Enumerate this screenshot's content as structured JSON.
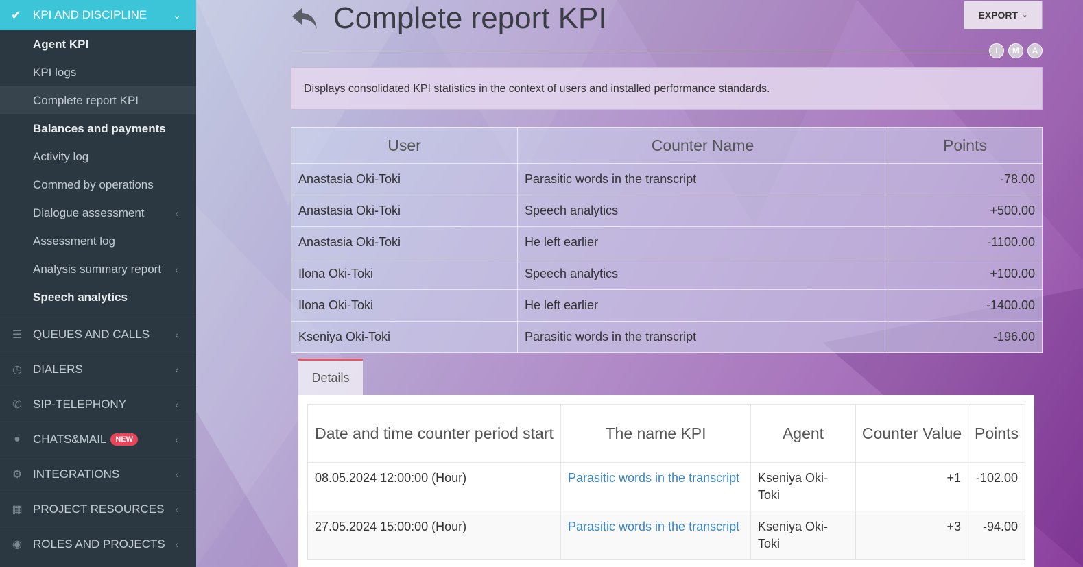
{
  "sidebar": {
    "top": {
      "label": "KPI AND DISCIPLINE",
      "icon": "check-icon"
    },
    "subitems": [
      {
        "label": "Agent KPI"
      },
      {
        "label": "KPI logs"
      },
      {
        "label": "Complete report KPI"
      },
      {
        "label": "Balances and payments"
      },
      {
        "label": "Activity log"
      },
      {
        "label": "Commed by operations"
      },
      {
        "label": "Dialogue assessment"
      },
      {
        "label": "Assessment log"
      },
      {
        "label": "Analysis summary report"
      },
      {
        "label": "Speech analytics"
      }
    ],
    "groups": [
      {
        "label": "QUEUES AND CALLS",
        "icon": "list-icon"
      },
      {
        "label": "DIALERS",
        "icon": "clock-icon"
      },
      {
        "label": "SIP-TELEPHONY",
        "icon": "phone-icon"
      },
      {
        "label": "CHATS&MAIL",
        "icon": "chat-icon",
        "badge": "NEW"
      },
      {
        "label": "INTEGRATIONS",
        "icon": "gears-icon"
      },
      {
        "label": "PROJECT RESOURCES",
        "icon": "grid-icon"
      },
      {
        "label": "ROLES AND PROJECTS",
        "icon": "toggle-icon"
      }
    ]
  },
  "header": {
    "title": "Complete report KPI",
    "export_label": "EXPORT",
    "circles": [
      "I",
      "M",
      "A"
    ]
  },
  "description": "Displays consolidated KPI statistics in the context of users and installed performance standards.",
  "summary_table": {
    "headers": [
      "User",
      "Counter Name",
      "Points"
    ],
    "rows": [
      [
        "Anastasia Oki-Toki",
        "Parasitic words in the transcript",
        "-78.00"
      ],
      [
        "Anastasia Oki-Toki",
        "Speech analytics",
        "+500.00"
      ],
      [
        "Anastasia Oki-Toki",
        "He left earlier",
        "-1100.00"
      ],
      [
        "Ilona Oki-Toki",
        "Speech analytics",
        "+100.00"
      ],
      [
        "Ilona Oki-Toki",
        "He left earlier",
        "-1400.00"
      ],
      [
        "Kseniya Oki-Toki",
        "Parasitic words in the transcript",
        "-196.00"
      ]
    ]
  },
  "details": {
    "tab_label": "Details",
    "headers": [
      "Date and time counter period start",
      "The name KPI",
      "Agent",
      "Counter Value",
      "Points"
    ],
    "rows": [
      [
        "08.05.2024 12:00:00 (Hour)",
        "Parasitic words in the transcript",
        "Kseniya Oki-Toki",
        "+1",
        "-102.00"
      ],
      [
        "27.05.2024 15:00:00 (Hour)",
        "Parasitic words in the transcript",
        "Kseniya Oki-Toki",
        "+3",
        "-94.00"
      ]
    ]
  }
}
